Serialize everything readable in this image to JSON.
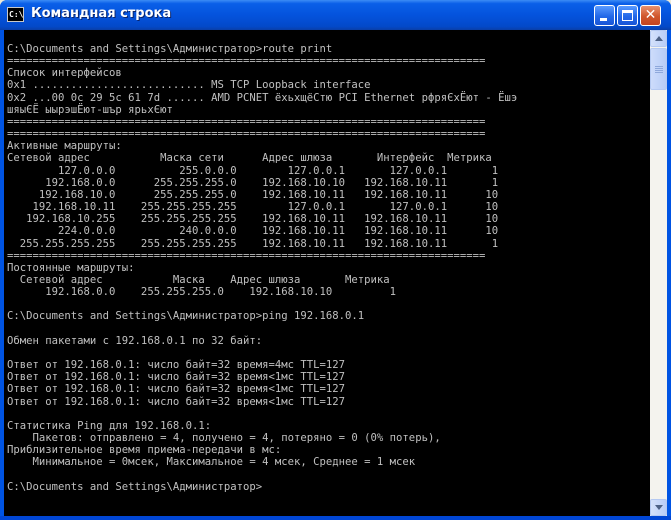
{
  "window": {
    "title": "Командная строка",
    "icon_label": "C:\\",
    "icon": "console-icon",
    "buttons": {
      "minimize": "minimize-icon",
      "maximize": "maximize-icon",
      "close": "✕"
    }
  },
  "console": {
    "lines": [
      "C:\\Documents and Settings\\Администратор>route print",
      "===========================================================================",
      "Список интерфейсов",
      "0x1 ........................... MS TCP Loopback interface",
      "0x2 ...00 0c 29 5c 61 7d ...... AMD PCNET ёхьхщёСтю PCI Ethernet рфряЄхЁют - Ёшэ",
      "шяыЄЁ ыырэшЁют-шър ярьхЄют",
      "===========================================================================",
      "===========================================================================",
      "Активные маршруты:",
      "Сетевой адрес           Маска сети      Адрес шлюза       Интерфейс  Метрика",
      "        127.0.0.0          255.0.0.0        127.0.0.1       127.0.0.1       1",
      "      192.168.0.0      255.255.255.0    192.168.10.10   192.168.10.11       1",
      "     192.168.10.0      255.255.255.0    192.168.10.11   192.168.10.11      10",
      "    192.168.10.11    255.255.255.255        127.0.0.1       127.0.0.1      10",
      "   192.168.10.255    255.255.255.255    192.168.10.11   192.168.10.11      10",
      "        224.0.0.0          240.0.0.0    192.168.10.11   192.168.10.11      10",
      "  255.255.255.255    255.255.255.255    192.168.10.11   192.168.10.11       1",
      "===========================================================================",
      "Постоянные маршруты:",
      "  Сетевой адрес           Маска    Адрес шлюза       Метрика",
      "      192.168.0.0    255.255.255.0    192.168.10.10         1",
      "",
      "C:\\Documents and Settings\\Администратор>ping 192.168.0.1",
      "",
      "Обмен пакетами с 192.168.0.1 по 32 байт:",
      "",
      "Ответ от 192.168.0.1: число байт=32 время=4мс TTL=127",
      "Ответ от 192.168.0.1: число байт=32 время<1мс TTL=127",
      "Ответ от 192.168.0.1: число байт=32 время<1мс TTL=127",
      "Ответ от 192.168.0.1: число байт=32 время<1мс TTL=127",
      "",
      "Статистика Ping для 192.168.0.1:",
      "    Пакетов: отправлено = 4, получено = 4, потеряно = 0 (0% потерь),",
      "Приблизительное время приема-передачи в мс:",
      "    Минимальное = 0мсек, Максимальное = 4 мсек, Среднее = 1 мсек",
      "",
      "C:\\Documents and Settings\\Администратор>"
    ]
  },
  "scrollbar": {
    "up": "scroll-up-arrow-icon",
    "down": "scroll-down-arrow-icon",
    "position": 0
  },
  "colors": {
    "title_bar": "#0453DD",
    "console_bg": "#000000",
    "console_text": "#C0C0C0"
  }
}
